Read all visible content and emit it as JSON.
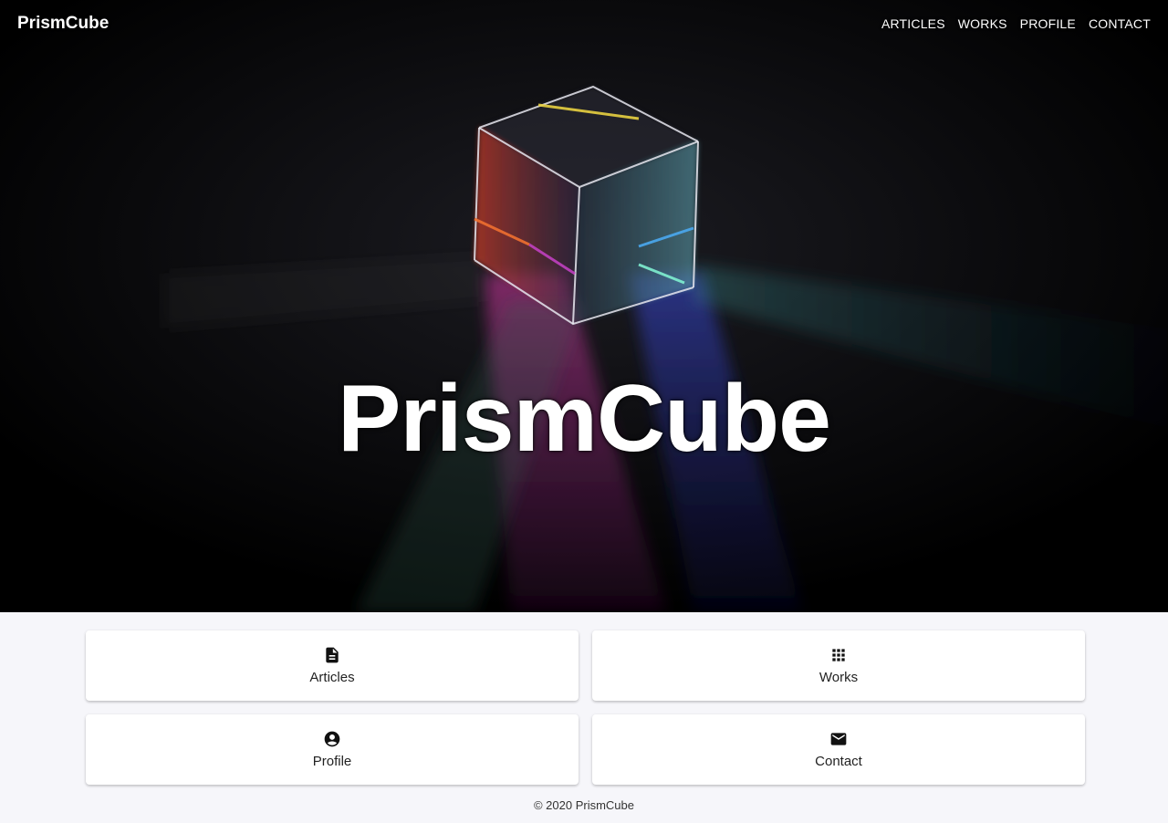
{
  "header": {
    "brand": "PrismCube",
    "nav": [
      "ARTICLES",
      "WORKS",
      "PROFILE",
      "CONTACT"
    ]
  },
  "hero": {
    "title": "PrismCube"
  },
  "cards": [
    {
      "label": "Articles",
      "icon": "document-icon"
    },
    {
      "label": "Works",
      "icon": "apps-grid-icon"
    },
    {
      "label": "Profile",
      "icon": "account-circle-icon"
    },
    {
      "label": "Contact",
      "icon": "mail-icon"
    }
  ],
  "footer": {
    "copyright": "© 2020 PrismCube"
  },
  "colors": {
    "hero_bg": "#000000",
    "page_bg": "#f6f6fa",
    "card_bg": "#ffffff"
  }
}
